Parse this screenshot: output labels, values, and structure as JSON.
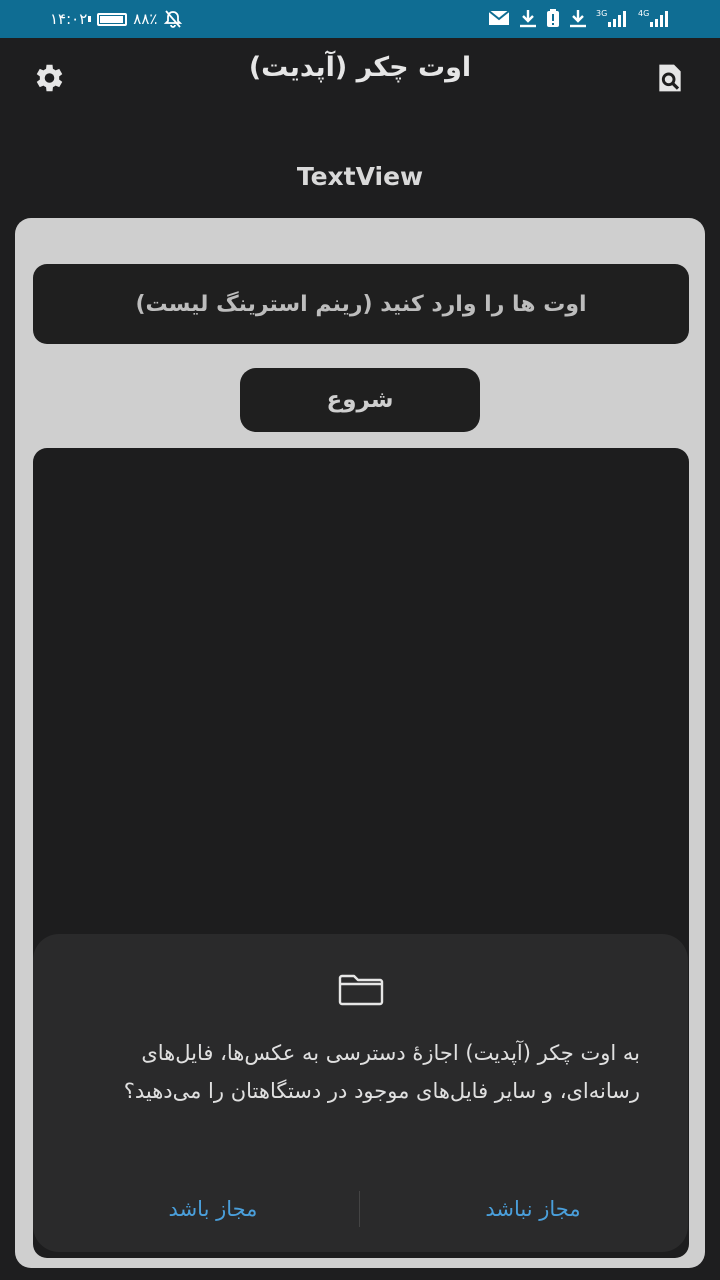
{
  "status_bar": {
    "time": "۱۴:۰۲",
    "battery_text": "۸۸٪",
    "battery_level": 0.88,
    "network_3g": "3G",
    "network_4g": "4G"
  },
  "app_bar": {
    "title": "اوت چکر (آپدیت)",
    "settings_icon": "gear-icon",
    "search_icon": "document-search-icon"
  },
  "main": {
    "textview_label": "TextView",
    "input_placeholder": "اوت ها را وارد کنید (رینم استرینگ لیست)",
    "start_button": "شروع"
  },
  "permission_dialog": {
    "icon": "folder-icon",
    "message": "به اوت چکر (آپدیت) اجازهٔ دسترسی به عکس‌ها، فایل‌های رسانه‌ای، و سایر فایل‌های موجود در دستگاهتان را می‌دهید؟",
    "deny_label": "مجاز نباشد",
    "allow_label": "مجاز باشد"
  },
  "colors": {
    "status_bar_bg": "#0f6d93",
    "background": "#1e1e1f",
    "card_bg": "#cfcfcf",
    "dialog_bg": "#2a2a2b",
    "accent": "#4a9fdb"
  }
}
